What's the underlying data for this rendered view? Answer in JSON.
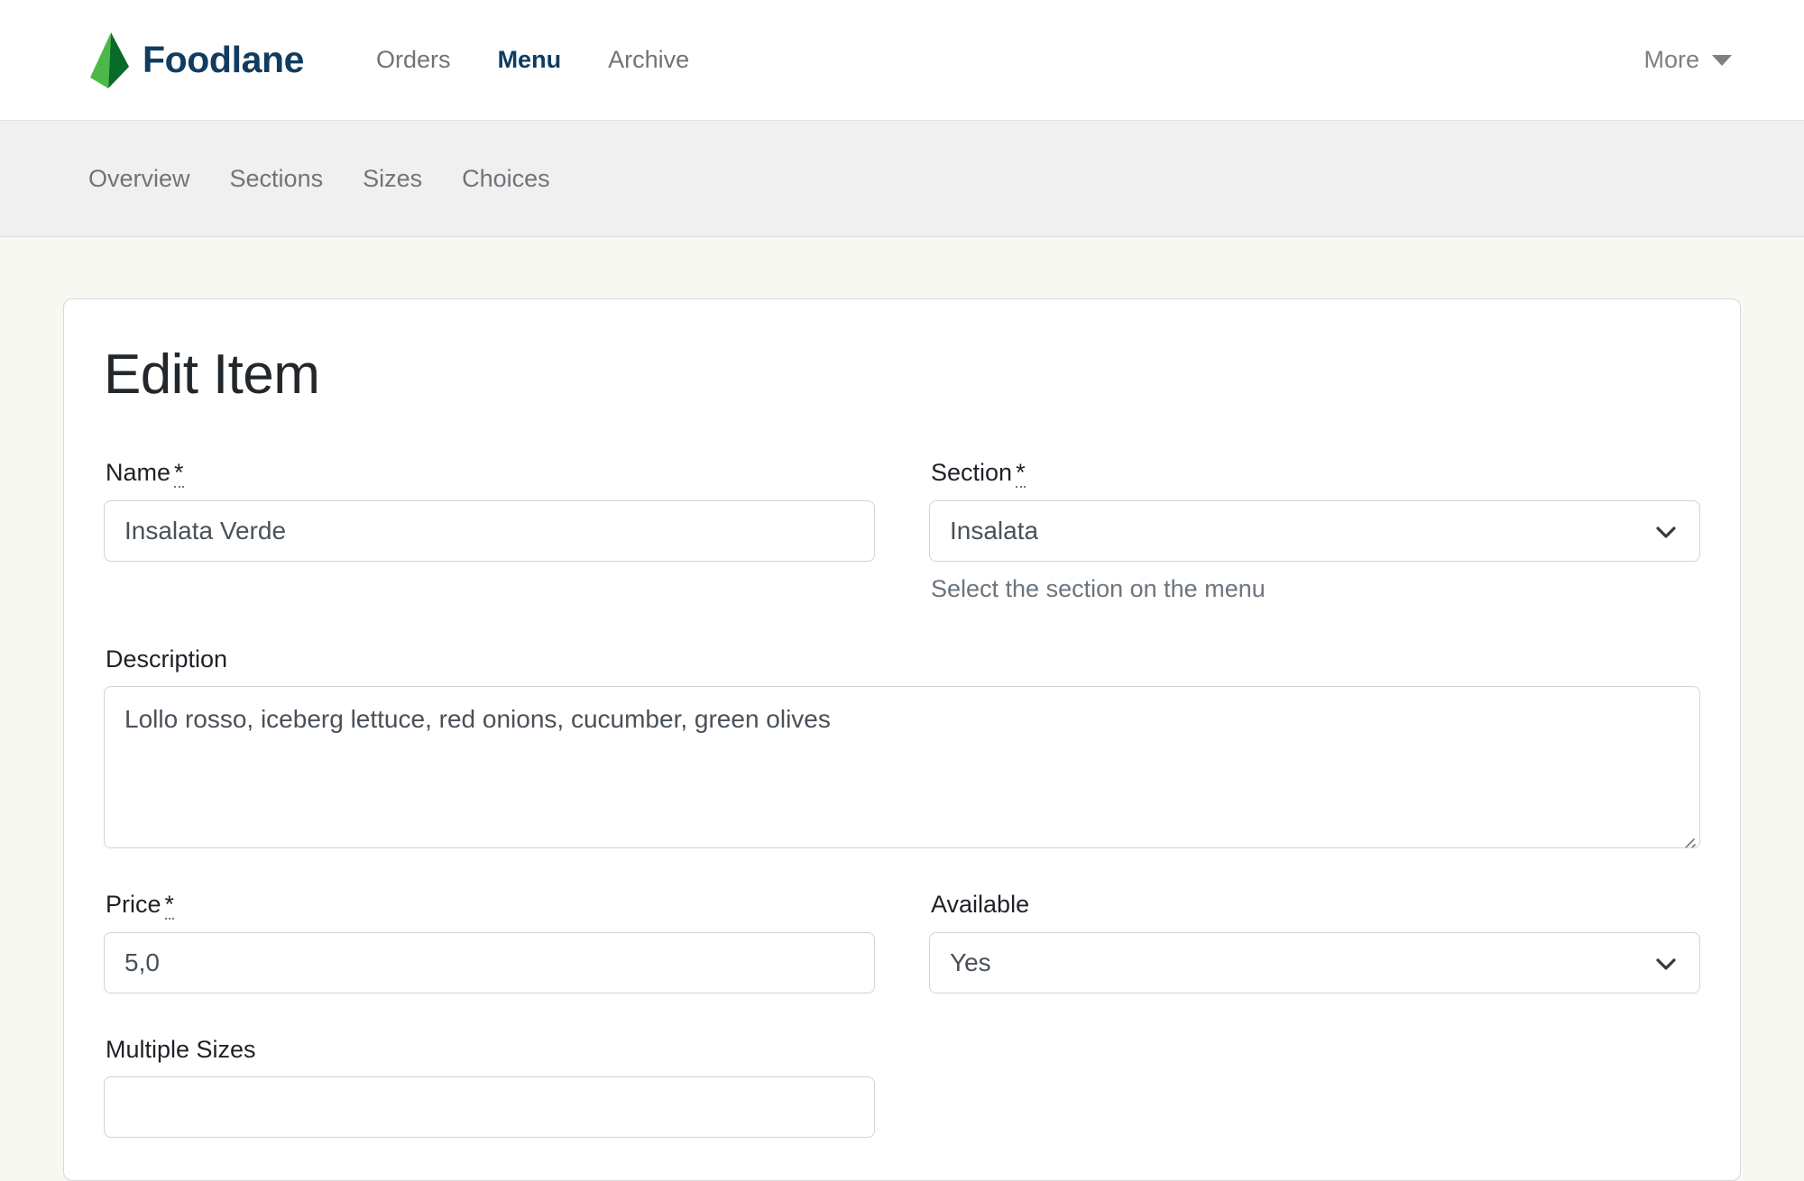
{
  "brand": {
    "name": "Foodlane",
    "logo_icon": "leaf-logo-icon",
    "logo_color_dark": "#086b28",
    "logo_color_light": "#4cb848"
  },
  "navbar": {
    "links": [
      {
        "label": "Orders",
        "active": false
      },
      {
        "label": "Menu",
        "active": true
      },
      {
        "label": "Archive",
        "active": false
      }
    ],
    "more": {
      "label": "More",
      "caret_icon": "chevron-down-icon"
    }
  },
  "subnav": {
    "items": [
      {
        "label": "Overview"
      },
      {
        "label": "Sections"
      },
      {
        "label": "Sizes"
      },
      {
        "label": "Choices"
      }
    ]
  },
  "card": {
    "title": "Edit Item"
  },
  "form": {
    "name": {
      "label": "Name",
      "required_mark": "*",
      "value": "Insalata Verde",
      "placeholder": ""
    },
    "section": {
      "label": "Section",
      "required_mark": "*",
      "value": "Insalata",
      "help": "Select the section on the menu",
      "chevron_icon": "chevron-down-icon"
    },
    "description": {
      "label": "Description",
      "value": "Lollo rosso, iceberg lettuce, red onions, cucumber, green olives",
      "placeholder": "",
      "resize_icon": "resize-grip-icon"
    },
    "price": {
      "label": "Price",
      "required_mark": "*",
      "value": "5,0",
      "placeholder": ""
    },
    "available": {
      "label": "Available",
      "value": "Yes",
      "chevron_icon": "chevron-down-icon"
    },
    "multiple_sizes": {
      "label": "Multiple Sizes",
      "value": ""
    }
  },
  "colors": {
    "brand_text": "#123c5f",
    "page_bg": "#f7f8f2",
    "subnav_bg": "#f0f0f0",
    "muted_text": "#6c757d"
  }
}
